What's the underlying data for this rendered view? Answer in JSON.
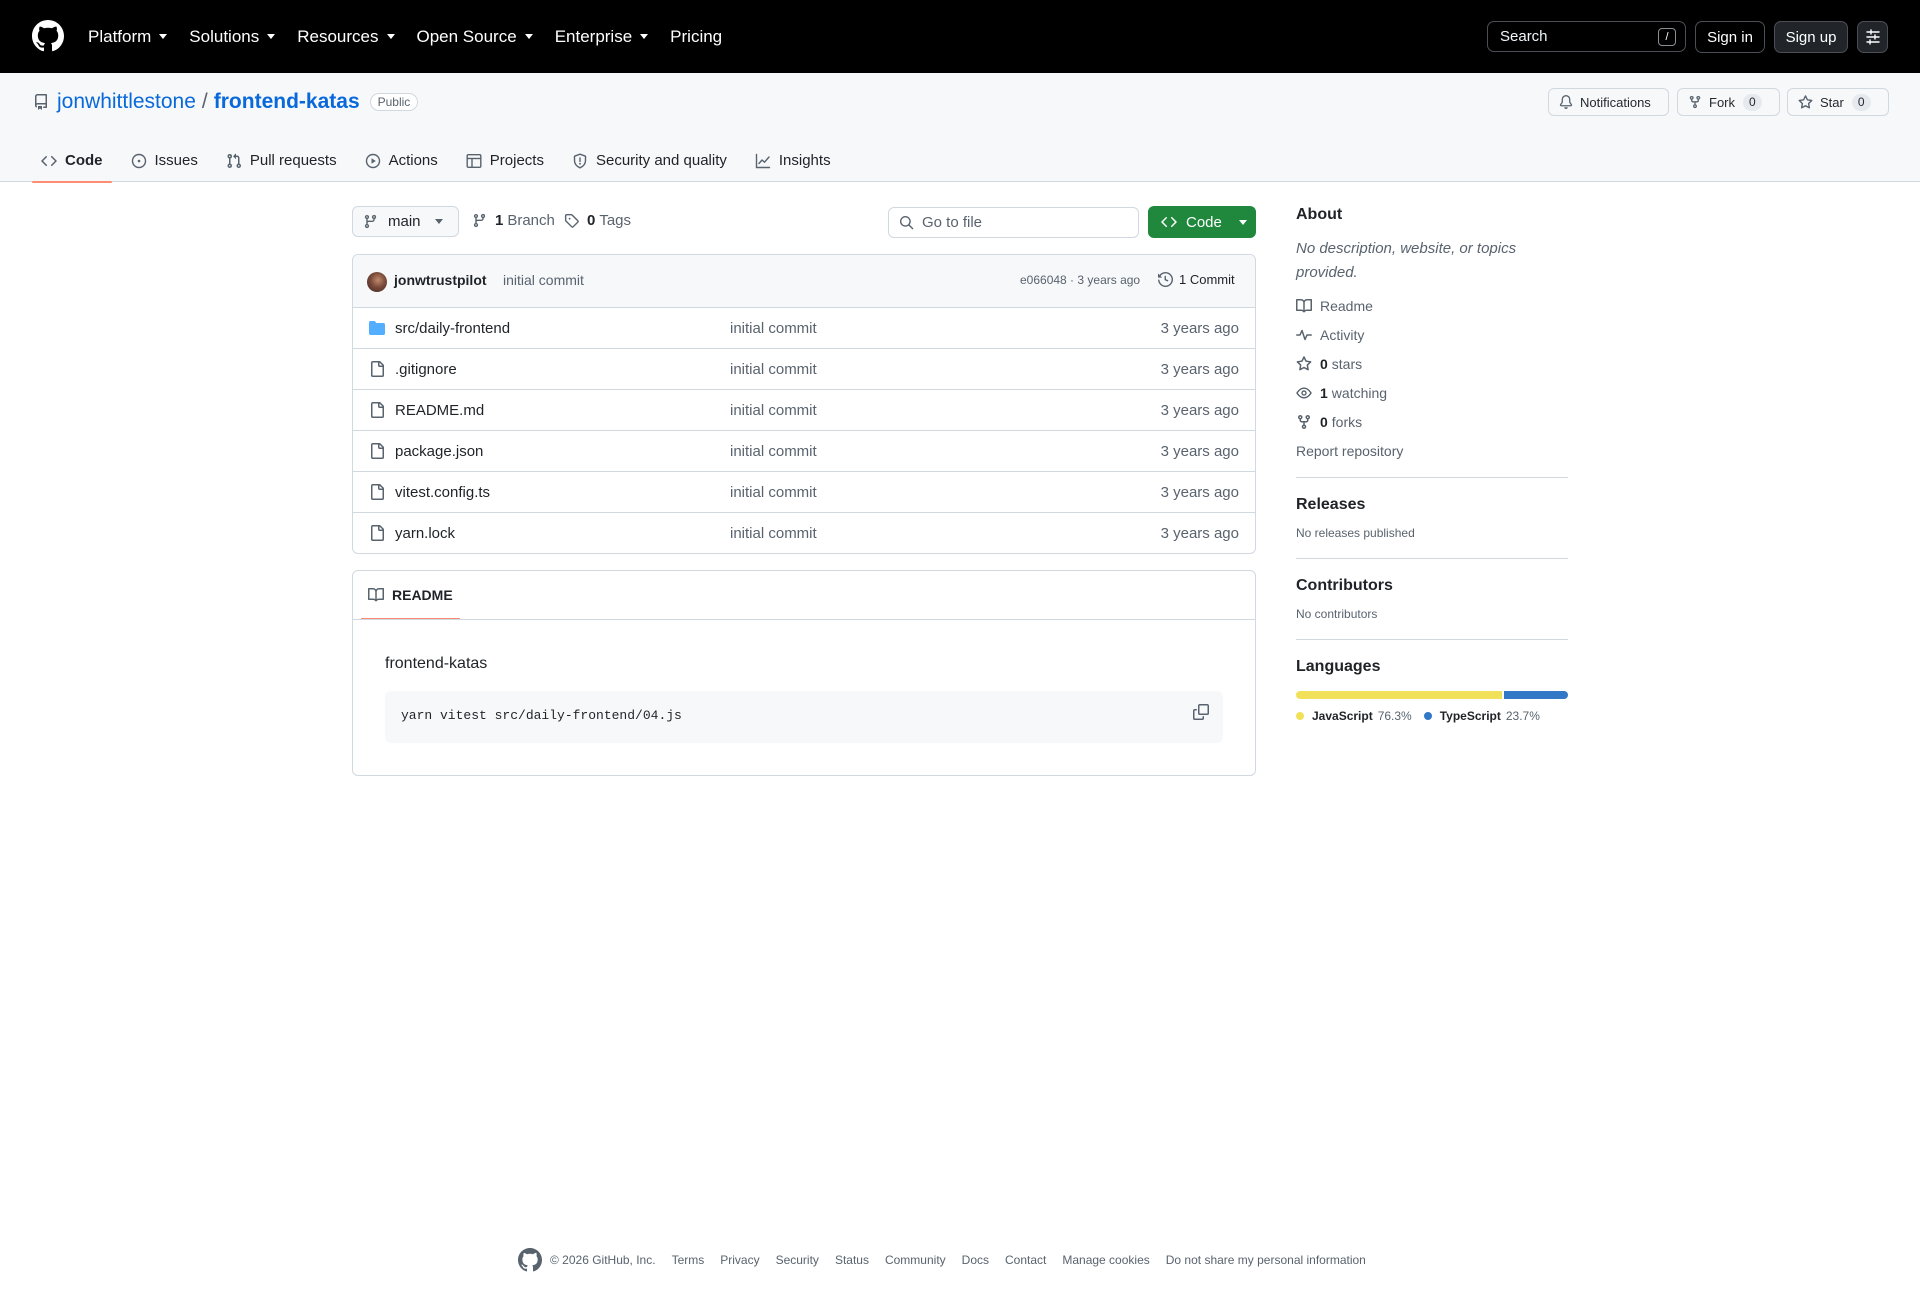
{
  "topnav": {
    "items": [
      "Platform",
      "Solutions",
      "Resources",
      "Open Source",
      "Enterprise",
      "Pricing"
    ],
    "search_label": "Search",
    "search_key": "/",
    "signin": "Sign in",
    "signup": "Sign up"
  },
  "repo": {
    "owner": "jonwhittlestone",
    "separator": "/",
    "name": "frontend-katas",
    "visibility": "Public",
    "notifications_label": "Notifications",
    "fork_label": "Fork",
    "fork_count": "0",
    "star_label": "Star",
    "star_count": "0"
  },
  "tabs": [
    "Code",
    "Issues",
    "Pull requests",
    "Actions",
    "Projects",
    "Security and quality",
    "Insights"
  ],
  "toolbar": {
    "branch": "main",
    "branch_count": "1",
    "branch_label": "Branch",
    "tag_count": "0",
    "tag_label": "Tags",
    "goto_placeholder": "Go to file",
    "code_label": "Code"
  },
  "commit": {
    "author": "jonwtrustpilot",
    "message": "initial commit",
    "hash_age": "e066048 · 3 years ago",
    "count": "1 Commit"
  },
  "files": [
    {
      "name": "src/daily-frontend",
      "type": "folder",
      "commit": "initial commit",
      "age": "3 years ago"
    },
    {
      "name": ".gitignore",
      "type": "file",
      "commit": "initial commit",
      "age": "3 years ago"
    },
    {
      "name": "README.md",
      "type": "file",
      "commit": "initial commit",
      "age": "3 years ago"
    },
    {
      "name": "package.json",
      "type": "file",
      "commit": "initial commit",
      "age": "3 years ago"
    },
    {
      "name": "vitest.config.ts",
      "type": "file",
      "commit": "initial commit",
      "age": "3 years ago"
    },
    {
      "name": "yarn.lock",
      "type": "file",
      "commit": "initial commit",
      "age": "3 years ago"
    }
  ],
  "readme": {
    "tab": "README",
    "heading": "frontend-katas",
    "code": "yarn vitest src/daily-frontend/04.js"
  },
  "about": {
    "title": "About",
    "description": "No description, website, or topics provided.",
    "readme": "Readme",
    "activity": "Activity",
    "stars_count": "0",
    "stars_label": "stars",
    "watching_count": "1",
    "watching_label": "watching",
    "forks_count": "0",
    "forks_label": "forks",
    "report": "Report repository"
  },
  "releases": {
    "title": "Releases",
    "text": "No releases published"
  },
  "contributors": {
    "title": "Contributors",
    "text": "No contributors"
  },
  "languages": {
    "title": "Languages",
    "items": [
      {
        "name": "JavaScript",
        "percent": "76.3%",
        "value": 76.3,
        "color": "#f1e05a"
      },
      {
        "name": "TypeScript",
        "percent": "23.7%",
        "value": 23.7,
        "color": "#3178c6"
      }
    ]
  },
  "footer": {
    "copyright": "© 2026 GitHub, Inc.",
    "links": [
      "Terms",
      "Privacy",
      "Security",
      "Status",
      "Community",
      "Docs",
      "Contact",
      "Manage cookies",
      "Do not share my personal information"
    ]
  }
}
